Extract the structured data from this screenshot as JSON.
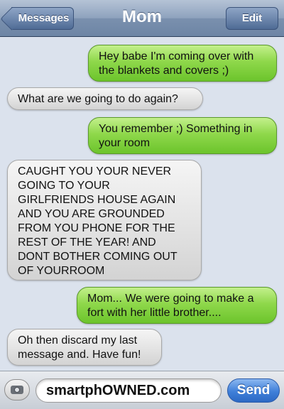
{
  "header": {
    "back_label": "Messages",
    "title": "Mom",
    "edit_label": "Edit"
  },
  "messages": [
    {
      "from": "me",
      "text": "Hey babe I'm coming over with\nthe blankets and covers ;)"
    },
    {
      "from": "them",
      "text": "What are we going to do again?"
    },
    {
      "from": "me",
      "text": "You remember ;) Something in\nyour room"
    },
    {
      "from": "them",
      "text": "CAUGHT YOU YOUR NEVER\nGOING TO YOUR\nGIRLFRIENDS HOUSE AGAIN\nAND YOU ARE GROUNDED\nFROM YOU PHONE FOR THE\nREST OF THE YEAR! AND\nDONT BOTHER COMING OUT\nOF YOURROOM"
    },
    {
      "from": "me",
      "text": "Mom... We were going to make a\nfort with her little brother...."
    },
    {
      "from": "them",
      "text": "Oh then discard my last\nmessage and. Have fun!"
    }
  ],
  "footer": {
    "input_value": "smartphOWNED.com",
    "send_label": "Send",
    "camera_icon": "camera-icon"
  },
  "colors": {
    "sent_bubble": "#8fd84b",
    "received_bubble": "#e3e3e3",
    "nav_bar": "#7a90ae",
    "send_button": "#3f7fd9",
    "background": "#dbe2ed"
  }
}
